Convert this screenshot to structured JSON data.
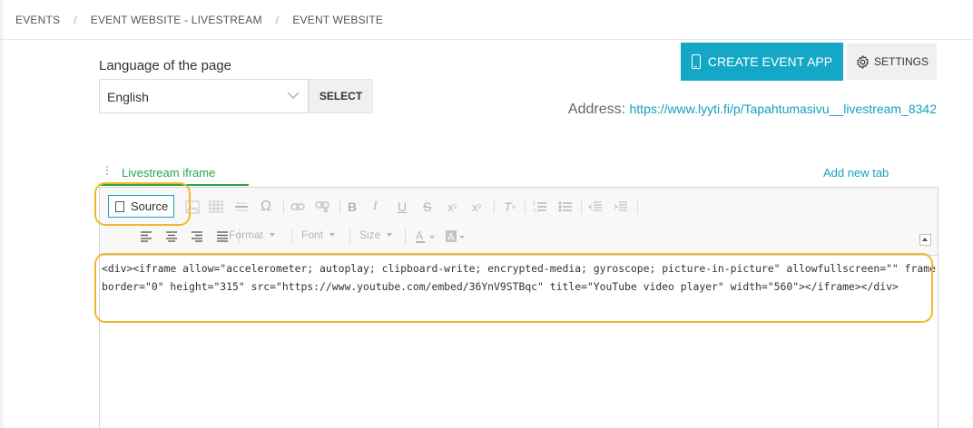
{
  "breadcrumb": [
    "EVENTS",
    "EVENT WEBSITE - LIVESTREAM",
    "EVENT WEBSITE"
  ],
  "language": {
    "label": "Language of the page",
    "selected": "English",
    "select_button": "SELECT"
  },
  "actions": {
    "create_app": "CREATE EVENT APP",
    "settings": "SETTINGS"
  },
  "address": {
    "label": "Address:",
    "url": "https://www.lyyti.fi/p/Tapahtumasivu__livestream_8342"
  },
  "tabs": {
    "active": "Livestream iframe",
    "add_new": "Add new tab"
  },
  "editor": {
    "source_label": "Source",
    "format_label": "Format",
    "font_label": "Font",
    "size_label": "Size",
    "content": "<div><iframe allow=\"accelerometer; autoplay; clipboard-write; encrypted-media; gyroscope; picture-in-picture\" allowfullscreen=\"\" frameborder=\"0\" height=\"315\" src=\"https://www.youtube.com/embed/36YnV9STBqc\" title=\"YouTube video player\" width=\"560\"></iframe></div>"
  },
  "colors": {
    "primary": "#15a8c6",
    "link": "#15a0bd",
    "active_tab": "#2aa548",
    "highlight": "#f2b829"
  }
}
